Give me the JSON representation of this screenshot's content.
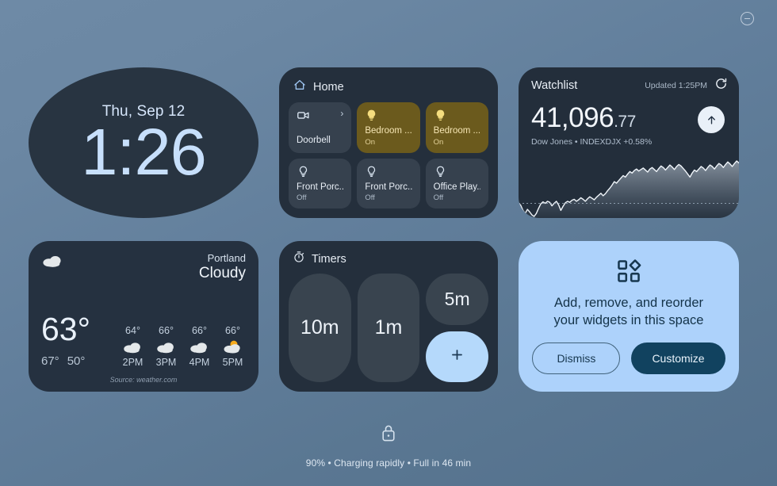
{
  "status_bar": {
    "dnd_icon": "do-not-disturb-icon"
  },
  "clock": {
    "date": "Thu, Sep 12",
    "time": "1:26"
  },
  "home": {
    "title": "Home",
    "icon": "home-icon",
    "tiles": [
      {
        "name": "Doorbell",
        "state": "",
        "icon": "video-camera-icon",
        "status": "camera",
        "chevron": "›"
      },
      {
        "name": "Bedroom ...",
        "state": "On",
        "icon": "lightbulb-filled-icon",
        "status": "on"
      },
      {
        "name": "Bedroom ...",
        "state": "On",
        "icon": "lightbulb-filled-icon",
        "status": "on"
      },
      {
        "name": "Front Porc...",
        "state": "Off",
        "icon": "lightbulb-outline-icon",
        "status": "off"
      },
      {
        "name": "Front Porc...",
        "state": "Off",
        "icon": "lightbulb-outline-icon",
        "status": "off"
      },
      {
        "name": "Office Play...",
        "state": "Off",
        "icon": "lightbulb-outline-icon",
        "status": "off"
      }
    ]
  },
  "watchlist": {
    "title": "Watchlist",
    "updated": "Updated 1:25PM",
    "refresh_icon": "refresh-icon",
    "price_whole": "41,096",
    "price_cents": ".77",
    "subline": "Dow Jones • INDEXDJX  +0.58%",
    "arrow_icon": "arrow-up-icon",
    "chart_data": {
      "type": "area",
      "title": "Dow Jones intraday",
      "xlabel": "",
      "ylabel": "",
      "grid": false,
      "legend": null,
      "baseline": 40860,
      "values": [
        40865,
        40840,
        40790,
        40760,
        40800,
        40775,
        40745,
        40730,
        40760,
        40810,
        40855,
        40875,
        40860,
        40880,
        40870,
        40835,
        40860,
        40880,
        40845,
        40790,
        40830,
        40865,
        40880,
        40870,
        40890,
        40900,
        40880,
        40895,
        40915,
        40900,
        40880,
        40905,
        40925,
        40910,
        40895,
        40920,
        40940,
        40960,
        40935,
        40955,
        40985,
        41010,
        41040,
        41075,
        41060,
        41085,
        41110,
        41135,
        41120,
        41150,
        41175,
        41160,
        41185,
        41200,
        41180,
        41195,
        41210,
        41190,
        41170,
        41200,
        41215,
        41195,
        41175,
        41205,
        41230,
        41215,
        41190,
        41215,
        41240,
        41220,
        41195,
        41225,
        41245,
        41230,
        41205,
        41180,
        41150,
        41120,
        41160,
        41190,
        41175,
        41200,
        41225,
        41210,
        41185,
        41215,
        41240,
        41225,
        41200,
        41230,
        41255,
        41240,
        41215,
        41245,
        41270,
        41250,
        41225,
        41255,
        41280,
        41260
      ]
    }
  },
  "weather": {
    "city": "Portland",
    "condition": "Cloudy",
    "icon": "cloud-icon",
    "current_temp": "63°",
    "high": "67°",
    "low": "50°",
    "source": "Source: weather.com",
    "hourly": [
      {
        "temp": "64°",
        "icon": "cloud-icon",
        "time": "2PM"
      },
      {
        "temp": "66°",
        "icon": "cloud-icon",
        "time": "3PM"
      },
      {
        "temp": "66°",
        "icon": "cloud-icon",
        "time": "4PM"
      },
      {
        "temp": "66°",
        "icon": "sun-behind-cloud-icon",
        "time": "5PM"
      }
    ]
  },
  "timers": {
    "title": "Timers",
    "icon": "stopwatch-icon",
    "buttons": [
      {
        "label": "10m"
      },
      {
        "label": "1m"
      },
      {
        "label": "5m"
      }
    ],
    "add_label": "+",
    "add_icon": "plus-icon"
  },
  "promo": {
    "icon": "widgets-icon",
    "line1": "Add, remove, and reorder",
    "line2": "your widgets in this space",
    "dismiss_label": "Dismiss",
    "customize_label": "Customize"
  },
  "bottom": {
    "lock_icon": "lock-icon",
    "battery_text": "90% • Charging rapidly • Full in 46 min"
  },
  "colors": {
    "background_top": "#6e8aa6",
    "background_bottom": "#53708c",
    "widget_dark": "#242f3c",
    "accent_light_blue": "#add2fb",
    "tile_on": "#6b5a1d",
    "customize_button": "#11425f"
  }
}
